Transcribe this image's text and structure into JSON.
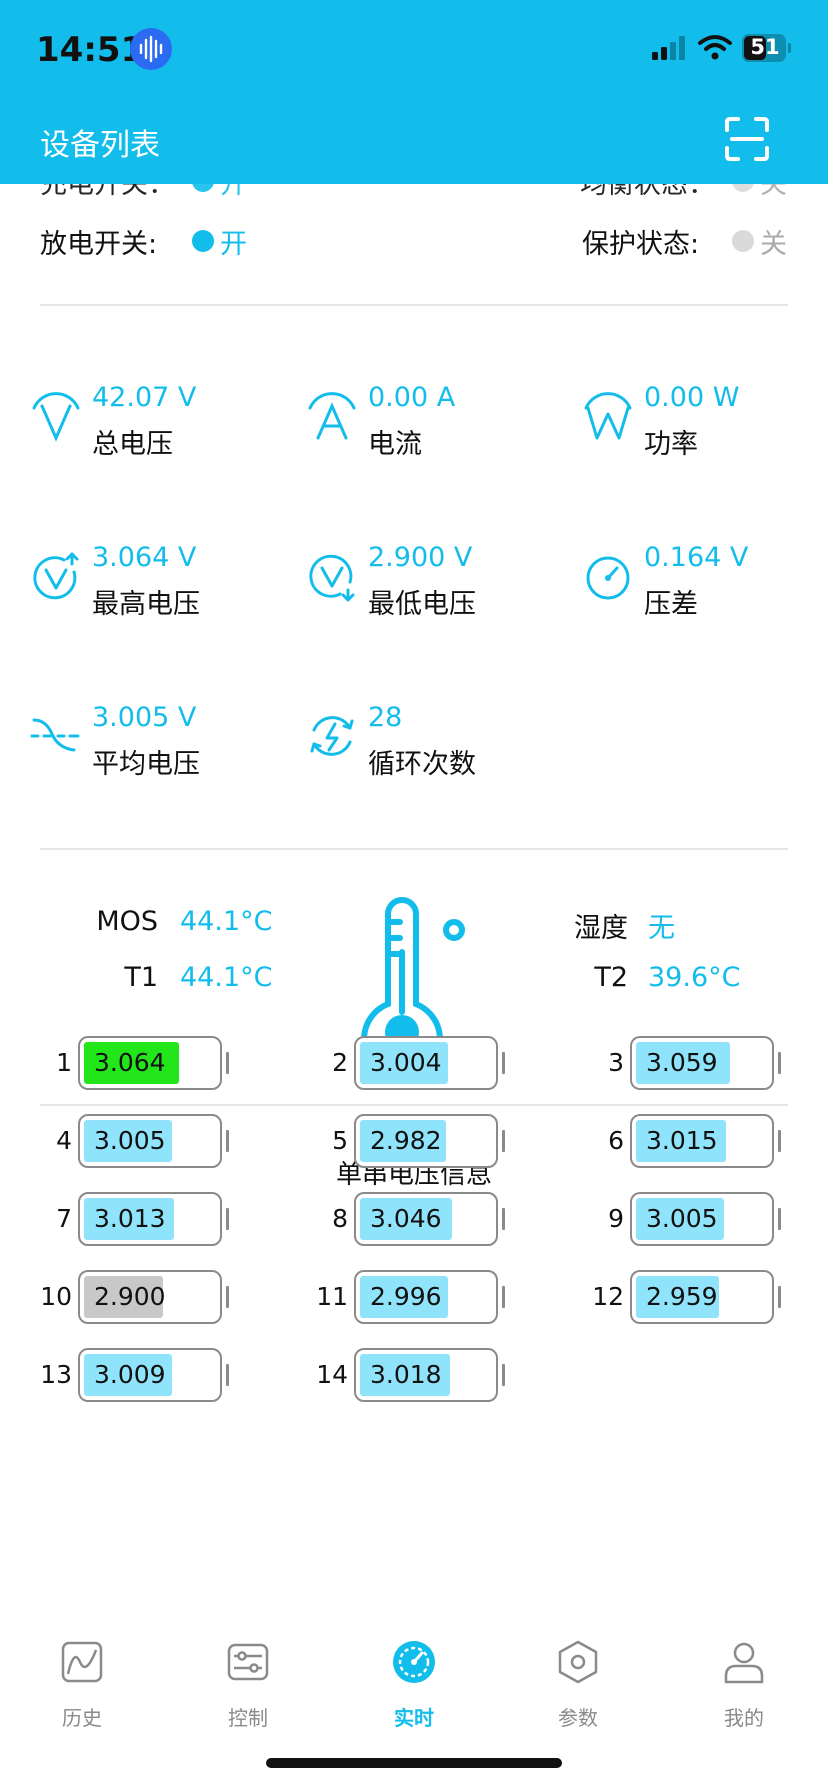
{
  "status_bar": {
    "time": "14:51",
    "battery": "51"
  },
  "header": {
    "title": "设备列表"
  },
  "switches": {
    "partial_left": "充电开关：",
    "partial_left_value": "开",
    "partial_right": "均衡状态：",
    "partial_right_value": "关",
    "discharge_label": "放电开关:",
    "discharge_value": "开",
    "protect_label": "保护状态:",
    "protect_value": "关"
  },
  "metrics": [
    {
      "value": "42.07 V",
      "label": "总电压",
      "icon": "voltage-icon"
    },
    {
      "value": "0.00 A",
      "label": "电流",
      "icon": "current-icon"
    },
    {
      "value": "0.00 W",
      "label": "功率",
      "icon": "power-icon"
    },
    {
      "value": "3.064 V",
      "label": "最高电压",
      "icon": "max-voltage-icon"
    },
    {
      "value": "2.900 V",
      "label": "最低电压",
      "icon": "min-voltage-icon"
    },
    {
      "value": "0.164 V",
      "label": "压差",
      "icon": "gauge-icon"
    },
    {
      "value": "3.005 V",
      "label": "平均电压",
      "icon": "average-icon"
    },
    {
      "value": "28",
      "label": "循环次数",
      "icon": "cycle-icon"
    }
  ],
  "temperatures": {
    "mos_label": "MOS",
    "mos_value": "44.1°C",
    "t1_label": "T1",
    "t1_value": "44.1°C",
    "humidity_label": "湿度",
    "humidity_value": "无",
    "t2_label": "T2",
    "t2_value": "39.6°C"
  },
  "cells": {
    "title": "单串电压信息",
    "items": [
      {
        "index": "1",
        "voltage": "3.064",
        "fill": 0.72,
        "state": "max"
      },
      {
        "index": "2",
        "voltage": "3.004",
        "fill": 0.67,
        "state": "normal"
      },
      {
        "index": "3",
        "voltage": "3.059",
        "fill": 0.71,
        "state": "normal"
      },
      {
        "index": "4",
        "voltage": "3.005",
        "fill": 0.67,
        "state": "normal"
      },
      {
        "index": "5",
        "voltage": "2.982",
        "fill": 0.65,
        "state": "normal"
      },
      {
        "index": "6",
        "voltage": "3.015",
        "fill": 0.68,
        "state": "normal"
      },
      {
        "index": "7",
        "voltage": "3.013",
        "fill": 0.68,
        "state": "normal"
      },
      {
        "index": "8",
        "voltage": "3.046",
        "fill": 0.7,
        "state": "normal"
      },
      {
        "index": "9",
        "voltage": "3.005",
        "fill": 0.67,
        "state": "normal"
      },
      {
        "index": "10",
        "voltage": "2.900",
        "fill": 0.6,
        "state": "min"
      },
      {
        "index": "11",
        "voltage": "2.996",
        "fill": 0.67,
        "state": "normal"
      },
      {
        "index": "12",
        "voltage": "2.959",
        "fill": 0.63,
        "state": "normal"
      },
      {
        "index": "13",
        "voltage": "3.009",
        "fill": 0.67,
        "state": "normal"
      },
      {
        "index": "14",
        "voltage": "3.018",
        "fill": 0.68,
        "state": "normal"
      }
    ]
  },
  "tabs": [
    {
      "label": "历史",
      "icon": "history-chart-icon",
      "active": false
    },
    {
      "label": "控制",
      "icon": "sliders-icon",
      "active": false
    },
    {
      "label": "实时",
      "icon": "speedometer-icon",
      "active": true
    },
    {
      "label": "参数",
      "icon": "hex-nut-icon",
      "active": false
    },
    {
      "label": "我的",
      "icon": "person-icon",
      "active": false
    }
  ],
  "colors": {
    "accent": "#12BDEB",
    "cell_normal": "#8FE3FA",
    "cell_max": "#22E51A",
    "cell_min": "#C8C8C8",
    "switch_on": "#12BDEB",
    "switch_off": "#DADADA"
  }
}
